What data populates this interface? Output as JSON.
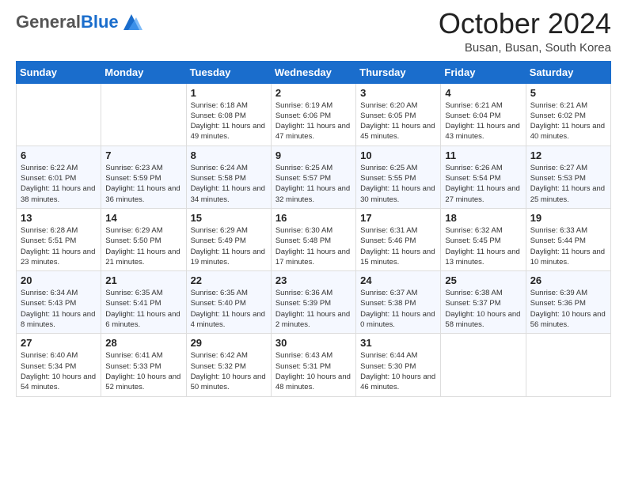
{
  "header": {
    "logo_general": "General",
    "logo_blue": "Blue",
    "month_title": "October 2024",
    "location": "Busan, Busan, South Korea"
  },
  "columns": [
    "Sunday",
    "Monday",
    "Tuesday",
    "Wednesday",
    "Thursday",
    "Friday",
    "Saturday"
  ],
  "weeks": [
    [
      {
        "day": "",
        "info": ""
      },
      {
        "day": "",
        "info": ""
      },
      {
        "day": "1",
        "info": "Sunrise: 6:18 AM\nSunset: 6:08 PM\nDaylight: 11 hours and 49 minutes."
      },
      {
        "day": "2",
        "info": "Sunrise: 6:19 AM\nSunset: 6:06 PM\nDaylight: 11 hours and 47 minutes."
      },
      {
        "day": "3",
        "info": "Sunrise: 6:20 AM\nSunset: 6:05 PM\nDaylight: 11 hours and 45 minutes."
      },
      {
        "day": "4",
        "info": "Sunrise: 6:21 AM\nSunset: 6:04 PM\nDaylight: 11 hours and 43 minutes."
      },
      {
        "day": "5",
        "info": "Sunrise: 6:21 AM\nSunset: 6:02 PM\nDaylight: 11 hours and 40 minutes."
      }
    ],
    [
      {
        "day": "6",
        "info": "Sunrise: 6:22 AM\nSunset: 6:01 PM\nDaylight: 11 hours and 38 minutes."
      },
      {
        "day": "7",
        "info": "Sunrise: 6:23 AM\nSunset: 5:59 PM\nDaylight: 11 hours and 36 minutes."
      },
      {
        "day": "8",
        "info": "Sunrise: 6:24 AM\nSunset: 5:58 PM\nDaylight: 11 hours and 34 minutes."
      },
      {
        "day": "9",
        "info": "Sunrise: 6:25 AM\nSunset: 5:57 PM\nDaylight: 11 hours and 32 minutes."
      },
      {
        "day": "10",
        "info": "Sunrise: 6:25 AM\nSunset: 5:55 PM\nDaylight: 11 hours and 30 minutes."
      },
      {
        "day": "11",
        "info": "Sunrise: 6:26 AM\nSunset: 5:54 PM\nDaylight: 11 hours and 27 minutes."
      },
      {
        "day": "12",
        "info": "Sunrise: 6:27 AM\nSunset: 5:53 PM\nDaylight: 11 hours and 25 minutes."
      }
    ],
    [
      {
        "day": "13",
        "info": "Sunrise: 6:28 AM\nSunset: 5:51 PM\nDaylight: 11 hours and 23 minutes."
      },
      {
        "day": "14",
        "info": "Sunrise: 6:29 AM\nSunset: 5:50 PM\nDaylight: 11 hours and 21 minutes."
      },
      {
        "day": "15",
        "info": "Sunrise: 6:29 AM\nSunset: 5:49 PM\nDaylight: 11 hours and 19 minutes."
      },
      {
        "day": "16",
        "info": "Sunrise: 6:30 AM\nSunset: 5:48 PM\nDaylight: 11 hours and 17 minutes."
      },
      {
        "day": "17",
        "info": "Sunrise: 6:31 AM\nSunset: 5:46 PM\nDaylight: 11 hours and 15 minutes."
      },
      {
        "day": "18",
        "info": "Sunrise: 6:32 AM\nSunset: 5:45 PM\nDaylight: 11 hours and 13 minutes."
      },
      {
        "day": "19",
        "info": "Sunrise: 6:33 AM\nSunset: 5:44 PM\nDaylight: 11 hours and 10 minutes."
      }
    ],
    [
      {
        "day": "20",
        "info": "Sunrise: 6:34 AM\nSunset: 5:43 PM\nDaylight: 11 hours and 8 minutes."
      },
      {
        "day": "21",
        "info": "Sunrise: 6:35 AM\nSunset: 5:41 PM\nDaylight: 11 hours and 6 minutes."
      },
      {
        "day": "22",
        "info": "Sunrise: 6:35 AM\nSunset: 5:40 PM\nDaylight: 11 hours and 4 minutes."
      },
      {
        "day": "23",
        "info": "Sunrise: 6:36 AM\nSunset: 5:39 PM\nDaylight: 11 hours and 2 minutes."
      },
      {
        "day": "24",
        "info": "Sunrise: 6:37 AM\nSunset: 5:38 PM\nDaylight: 11 hours and 0 minutes."
      },
      {
        "day": "25",
        "info": "Sunrise: 6:38 AM\nSunset: 5:37 PM\nDaylight: 10 hours and 58 minutes."
      },
      {
        "day": "26",
        "info": "Sunrise: 6:39 AM\nSunset: 5:36 PM\nDaylight: 10 hours and 56 minutes."
      }
    ],
    [
      {
        "day": "27",
        "info": "Sunrise: 6:40 AM\nSunset: 5:34 PM\nDaylight: 10 hours and 54 minutes."
      },
      {
        "day": "28",
        "info": "Sunrise: 6:41 AM\nSunset: 5:33 PM\nDaylight: 10 hours and 52 minutes."
      },
      {
        "day": "29",
        "info": "Sunrise: 6:42 AM\nSunset: 5:32 PM\nDaylight: 10 hours and 50 minutes."
      },
      {
        "day": "30",
        "info": "Sunrise: 6:43 AM\nSunset: 5:31 PM\nDaylight: 10 hours and 48 minutes."
      },
      {
        "day": "31",
        "info": "Sunrise: 6:44 AM\nSunset: 5:30 PM\nDaylight: 10 hours and 46 minutes."
      },
      {
        "day": "",
        "info": ""
      },
      {
        "day": "",
        "info": ""
      }
    ]
  ]
}
